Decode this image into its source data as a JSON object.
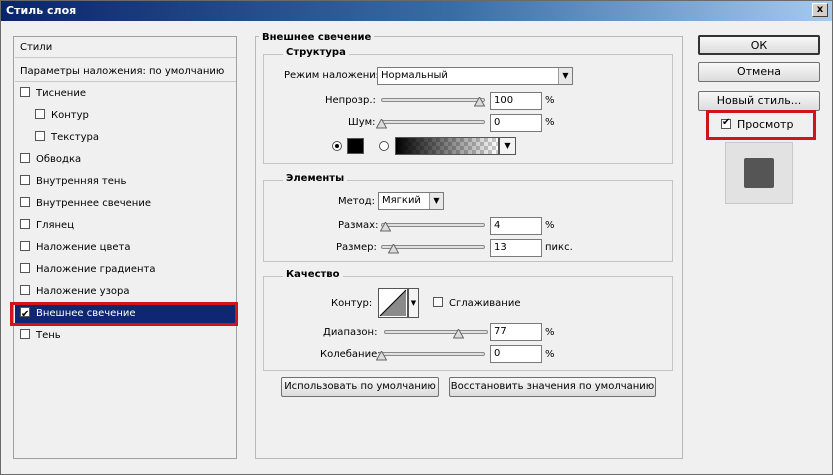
{
  "window": {
    "title": "Стиль слоя",
    "close_glyph": "x"
  },
  "left_panel": {
    "header": "Стили",
    "blend_defaults": "Параметры наложения: по умолчанию",
    "items": [
      {
        "label": "Тиснение",
        "checked": false
      },
      {
        "label": "Контур",
        "checked": false
      },
      {
        "label": "Текстура",
        "checked": false
      },
      {
        "label": "Обводка",
        "checked": false
      },
      {
        "label": "Внутренняя тень",
        "checked": false
      },
      {
        "label": "Внутреннее свечение",
        "checked": false
      },
      {
        "label": "Глянец",
        "checked": false
      },
      {
        "label": "Наложение цвета",
        "checked": false
      },
      {
        "label": "Наложение градиента",
        "checked": false
      },
      {
        "label": "Наложение узора",
        "checked": false
      },
      {
        "label": "Внешнее свечение",
        "checked": true,
        "selected": true
      },
      {
        "label": "Тень",
        "checked": false
      }
    ]
  },
  "main": {
    "section_title": "Внешнее свечение",
    "structure": {
      "title": "Структура",
      "blend_mode_label": "Режим наложения:",
      "blend_mode_value": "Нормальный",
      "opacity_label": "Непрозр.:",
      "opacity_value": "100",
      "noise_label": "Шум:",
      "noise_value": "0",
      "percent": "%",
      "color_swatch": "#000000"
    },
    "elements": {
      "title": "Элементы",
      "method_label": "Метод:",
      "method_value": "Мягкий",
      "spread_label": "Размах:",
      "spread_value": "4",
      "size_label": "Размер:",
      "size_value": "13",
      "percent": "%",
      "px_unit": "пикс."
    },
    "quality": {
      "title": "Качество",
      "contour_label": "Контур:",
      "antialias_label": "Сглаживание",
      "range_label": "Диапазон:",
      "range_value": "77",
      "jitter_label": "Колебание:",
      "jitter_value": "0",
      "percent": "%"
    },
    "buttons": {
      "make_default": "Использовать по умолчанию",
      "reset_default": "Восстановить значения по умолчанию"
    }
  },
  "right_panel": {
    "ok": "ОК",
    "cancel": "Отмена",
    "new_style": "Новый стиль...",
    "preview_label": "Просмотр",
    "preview_checked": true
  },
  "colors": {
    "highlight": "#d0141a",
    "selection": "#0f2672"
  }
}
